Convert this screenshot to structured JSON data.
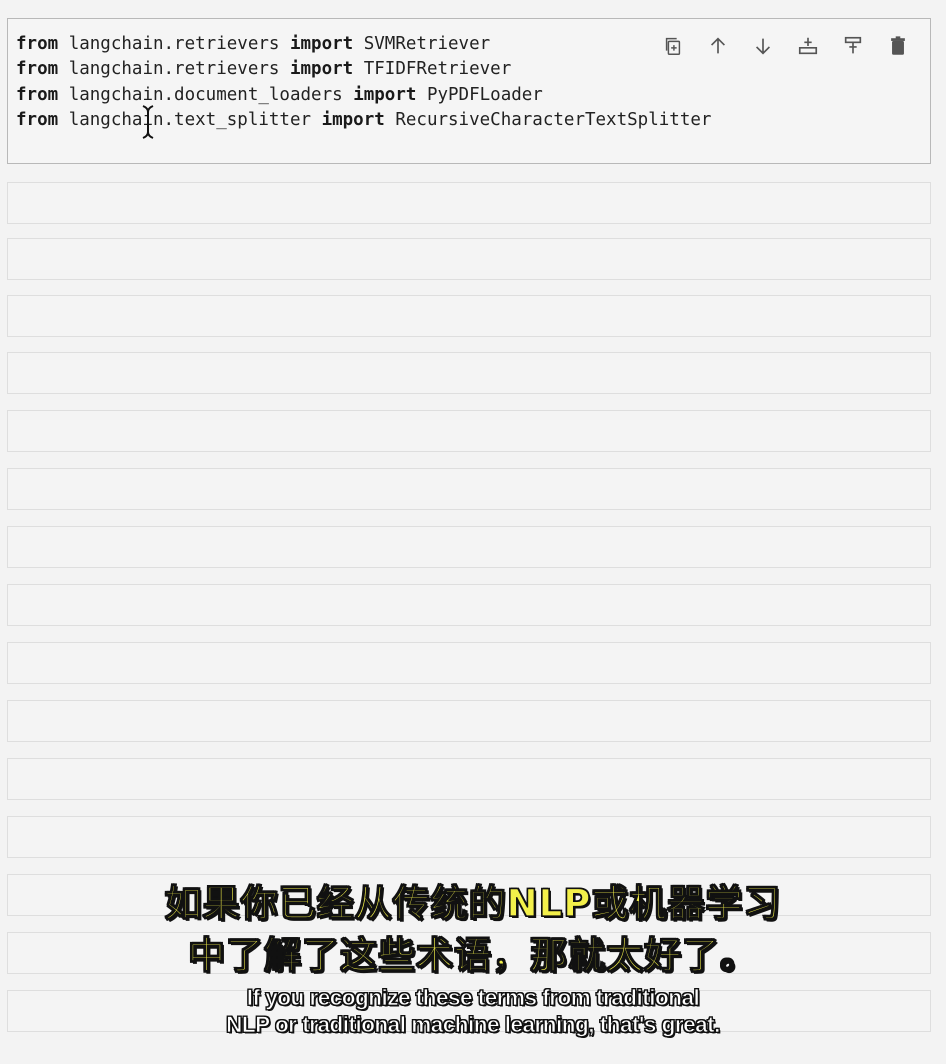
{
  "code_cell": {
    "lines": [
      {
        "kw1": "from",
        "module": "langchain.retrievers",
        "kw2": "import",
        "name": "SVMRetriever"
      },
      {
        "kw1": "from",
        "module": "langchain.retrievers",
        "kw2": "import",
        "name": "TFIDFRetriever"
      },
      {
        "kw1": "from",
        "module": "langchain.document_loaders",
        "kw2": "import",
        "name": "PyPDFLoader"
      },
      {
        "kw1": "from",
        "module": "langchain.text_splitter",
        "kw2": "import",
        "name": "RecursiveCharacterTextSplitter"
      }
    ]
  },
  "toolbar": {
    "icons": [
      "duplicate-icon",
      "move-up-icon",
      "move-down-icon",
      "insert-below-icon",
      "merge-icon",
      "delete-icon"
    ]
  },
  "subtitles": {
    "zh_line1": "如果你已经从传统的NLP或机器学习",
    "zh_line2": "中了解了这些术语，那就太好了。",
    "en_line1": "If you recognize these terms from traditional",
    "en_line2": "NLP or traditional machine learning, that's great."
  },
  "colors": {
    "background": "#f3f3f3",
    "subtitle_zh": "#f3f04a",
    "subtitle_en": "#ffffff"
  }
}
